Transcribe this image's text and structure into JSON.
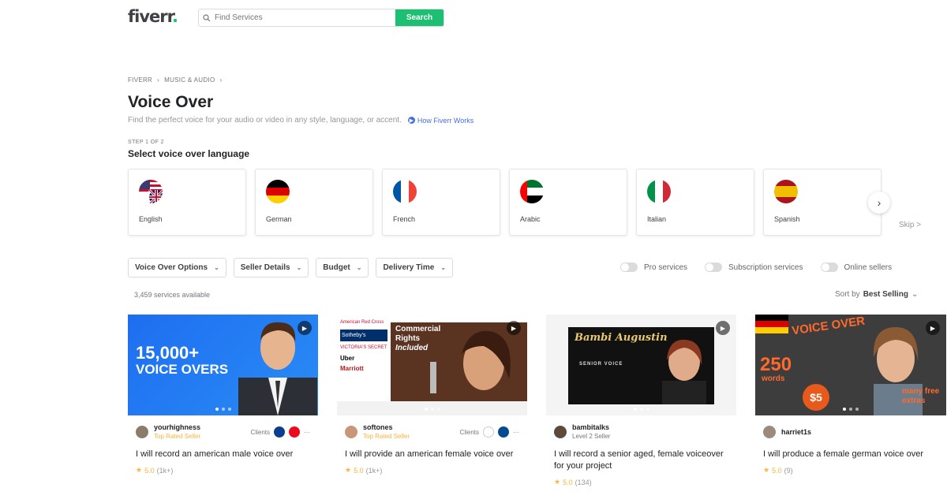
{
  "header": {
    "logo": "fiverr",
    "logo_dot": ".",
    "search_placeholder": "Find Services",
    "search_button": "Search"
  },
  "breadcrumb": [
    "FIVERR",
    "MUSIC & AUDIO"
  ],
  "page": {
    "title": "Voice Over",
    "subtitle": "Find the perfect voice for your audio or video in any style, language, or accent.",
    "how_link": "How Fiverr Works",
    "step": "STEP 1 OF 2",
    "step_title": "Select voice over language",
    "skip": "Skip >"
  },
  "languages": [
    {
      "label": "English",
      "flag": "us-uk-flag-icon"
    },
    {
      "label": "German",
      "flag": "germany-flag-icon"
    },
    {
      "label": "French",
      "flag": "france-flag-icon"
    },
    {
      "label": "Arabic",
      "flag": "uae-flag-icon"
    },
    {
      "label": "Italian",
      "flag": "italy-flag-icon"
    },
    {
      "label": "Spanish",
      "flag": "spain-flag-icon"
    }
  ],
  "filters": [
    "Voice Over Options",
    "Seller Details",
    "Budget",
    "Delivery Time"
  ],
  "toggles": [
    "Pro services",
    "Subscription services",
    "Online sellers"
  ],
  "results": {
    "count": "3,459 services available",
    "sort_label": "Sort by",
    "sort_value": "Best Selling"
  },
  "gigs": [
    {
      "seller": "yourhighness",
      "level": "Top Rated Seller",
      "clients_label": "Clients",
      "title": "I will record an american male voice over",
      "rating": "5.0",
      "reviews": "(1k+)",
      "thumb_text_1": "15,000+",
      "thumb_text_2": "VOICE OVERS"
    },
    {
      "seller": "softones",
      "level": "Top Rated Seller",
      "clients_label": "Clients",
      "title": "I will provide an american female voice over",
      "rating": "5.0",
      "reviews": "(1k+)",
      "thumb_text_1": "Commercial",
      "thumb_text_2": "Rights",
      "thumb_text_3": "Included",
      "brands": [
        "American Red Cross",
        "Sotheby's",
        "VICTORIA'S SECRET",
        "Uber",
        "Marriott"
      ]
    },
    {
      "seller": "bambitalks",
      "level": "Level 2 Seller",
      "title": "I will record a senior aged, female voiceover for your project",
      "rating": "5.0",
      "reviews": "(134)",
      "thumb_text_1": "Bambi Augustin",
      "thumb_text_2": "SENIOR VOICE"
    },
    {
      "seller": "harriet1s",
      "level": "",
      "title": "I will produce a female german voice over",
      "rating": "5.0",
      "reviews": "(9)",
      "thumb_text_1": "VOICE OVER",
      "thumb_text_2": "250",
      "thumb_text_3": "$5",
      "thumb_text_4": "many free extras",
      "thumb_text_5": "words"
    }
  ],
  "colors": {
    "brand": "#1dbf73",
    "link": "#446ee7",
    "rating": "#ffb33e"
  }
}
